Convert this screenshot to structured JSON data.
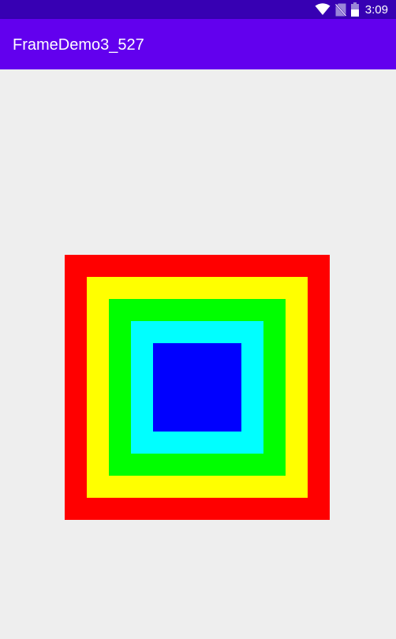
{
  "status_bar": {
    "time": "3:09",
    "icons": [
      "wifi-icon",
      "no-sim-icon",
      "battery-icon"
    ]
  },
  "app_bar": {
    "title": "FrameDemo3_527",
    "color": "#6200ee",
    "status_color": "#3700b3"
  },
  "frames": [
    {
      "name": "red",
      "color": "#ff0000"
    },
    {
      "name": "yellow",
      "color": "#ffff00"
    },
    {
      "name": "green",
      "color": "#00ff00"
    },
    {
      "name": "cyan",
      "color": "#00ffff"
    },
    {
      "name": "blue",
      "color": "#0000ff"
    }
  ]
}
